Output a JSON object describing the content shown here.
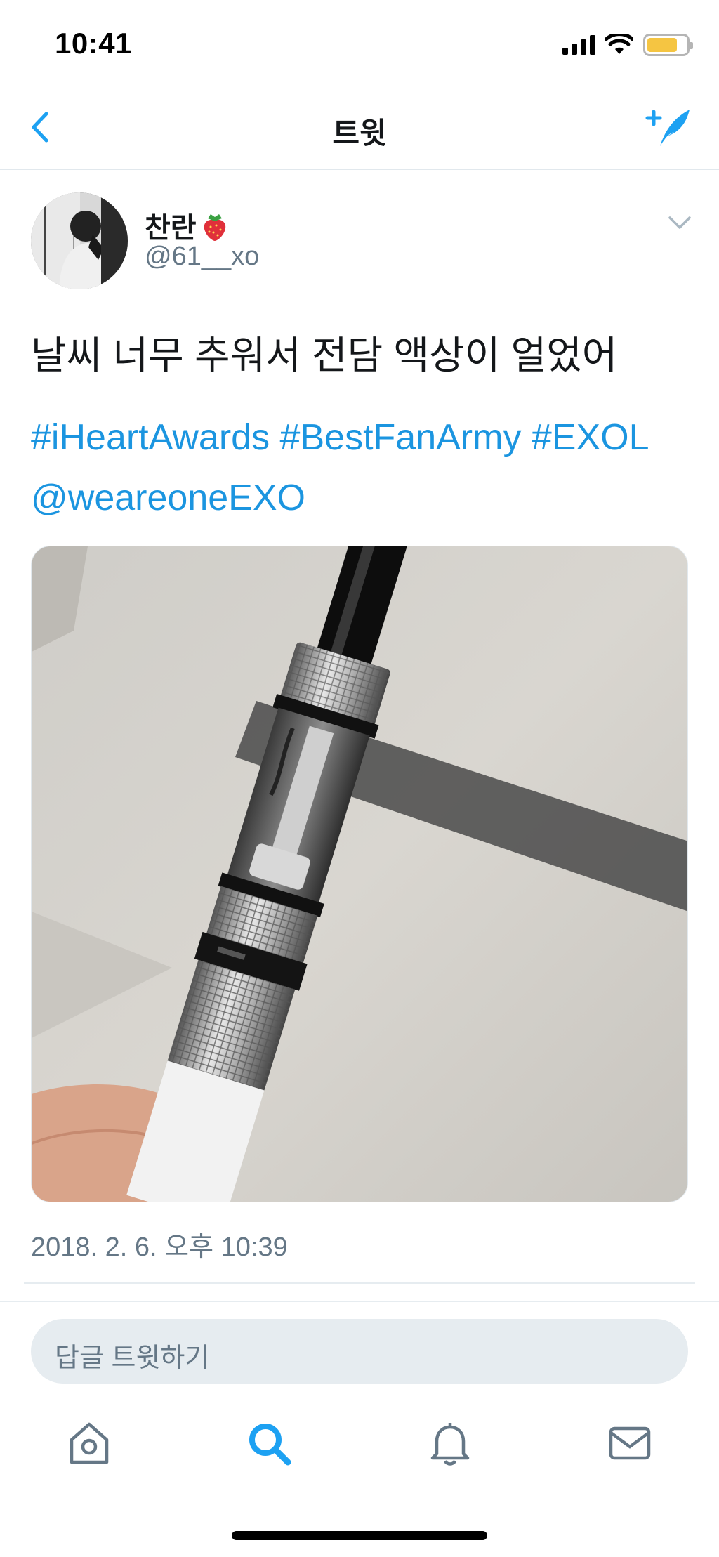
{
  "status_bar": {
    "time": "10:41",
    "battery_color": "#f5c542"
  },
  "nav": {
    "title": "트윗",
    "back_icon": "chevron-left-icon",
    "compose_icon": "compose-tweet-icon"
  },
  "tweet": {
    "display_name": "찬란",
    "name_emoji": "strawberry-icon",
    "handle": "@61__xo",
    "text": "날씨 너무 추워서 전담 액상이 얼었어",
    "hashtags": [
      "#iHeartAwards",
      "#BestFanArmy",
      "#EXOL"
    ],
    "mention": "@weareoneEXO",
    "timestamp": "2018. 2. 6. 오후 10:39",
    "link_color": "#1b95e0"
  },
  "reply": {
    "placeholder": "답글 트윗하기"
  },
  "tabs": [
    {
      "name": "home-icon",
      "active": false
    },
    {
      "name": "search-icon",
      "active": true
    },
    {
      "name": "notifications-icon",
      "active": false
    },
    {
      "name": "messages-icon",
      "active": false
    }
  ],
  "colors": {
    "accent": "#1da1f2",
    "text_primary": "#14171a",
    "text_secondary": "#657786"
  }
}
